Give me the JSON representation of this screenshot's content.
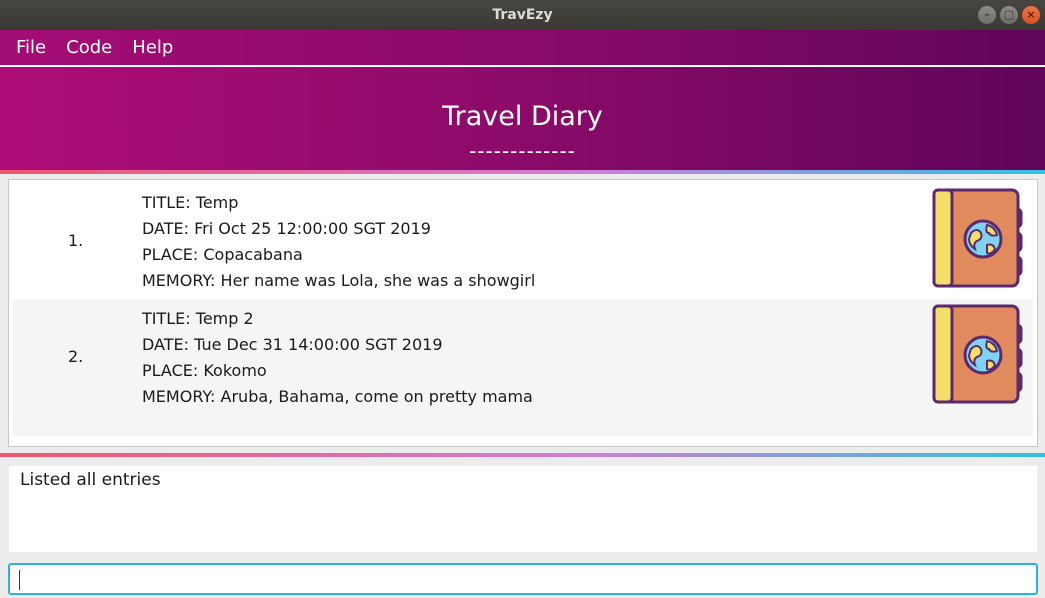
{
  "window": {
    "title": "TravEzy"
  },
  "menu": [
    {
      "label": "File"
    },
    {
      "label": "Code"
    },
    {
      "label": "Help"
    }
  ],
  "header": {
    "title": "Travel Diary",
    "underline": "-------------"
  },
  "entries": [
    {
      "index": "1.",
      "title": "TITLE: Temp",
      "date": "DATE: Fri Oct 25 12:00:00 SGT 2019",
      "place": "PLACE: Copacabana",
      "memory": "MEMORY: Her name was Lola, she was a showgirl",
      "icon": "passport-globe-icon"
    },
    {
      "index": "2.",
      "title": "TITLE: Temp 2",
      "date": "DATE: Tue Dec 31 14:00:00 SGT 2019",
      "place": "PLACE: Kokomo",
      "memory": "MEMORY: Aruba, Bahama, come on pretty mama",
      "icon": "passport-globe-icon"
    }
  ],
  "result": {
    "text": "Listed all entries"
  },
  "command": {
    "value": "",
    "placeholder": ""
  },
  "colors": {
    "menu_start": "#a30c76",
    "menu_end": "#61065a",
    "accent_line_start": "#f0566e",
    "accent_line_end": "#2ec2e4",
    "input_border": "#2eb1df"
  }
}
